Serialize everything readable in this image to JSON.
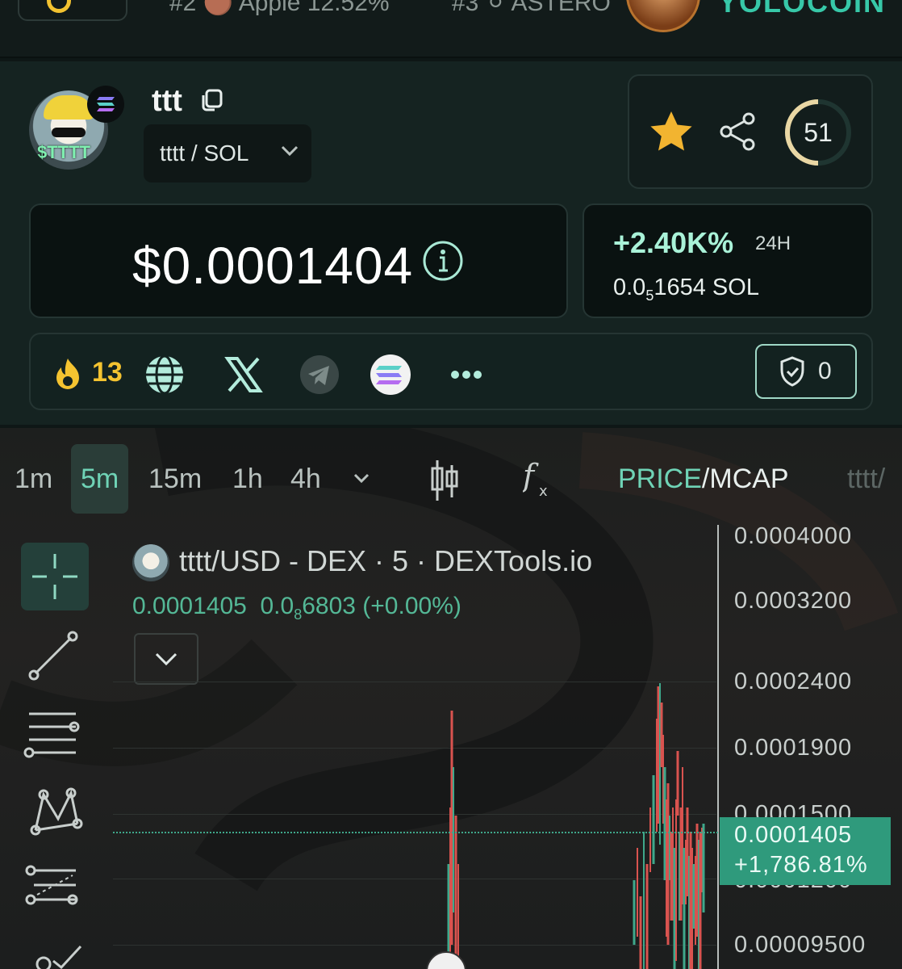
{
  "ticker": {
    "item2": "#2 🟤 Apple 12.52%",
    "item3": "#3 ⚪ ASTERO",
    "ad": "YOLOCOIN"
  },
  "token": {
    "name": "ttt",
    "pair": "tttt / SOL",
    "avatar_label": "$TTTT",
    "score": "51",
    "price": "$0.0001404",
    "change_pct": "+2.40K%",
    "change_period": "24H",
    "sol_price_prefix": "0.0",
    "sol_price_sub": "5",
    "sol_price_suffix": "1654 SOL",
    "hot_count": "13",
    "audit_count": "0"
  },
  "icons": [
    "solana-icon",
    "copy-icon",
    "chevron-down-icon",
    "star-icon",
    "share-icon",
    "info-icon",
    "fire-icon",
    "globe-icon",
    "x-icon",
    "telegram-icon",
    "solana-icon",
    "more-icon",
    "shield-icon"
  ],
  "chart": {
    "intervals": [
      "1m",
      "5m",
      "15m",
      "1h",
      "4h"
    ],
    "active_interval": "5m",
    "price_label": "PRICE",
    "mcap_label": "/MCAP",
    "symbol_tab": "tttt/",
    "legend_title": "tttt/USD - DEX · 5 · DEXTools.io",
    "legend_price": "0.0001405",
    "legend_change_prefix": "0.0",
    "legend_change_sub": "8",
    "legend_change_suffix": "6803 (+0.00%)",
    "y_ticks": [
      "0.0004000",
      "0.0003200",
      "0.0002400",
      "0.0001900",
      "0.0001500",
      "0.0001200",
      "0.00009500"
    ],
    "last_price": "0.0001405",
    "last_change": "+1,786.81%"
  },
  "colors": {
    "accent": "#6fd3b6",
    "up": "#3fa88b",
    "down": "#d9534f",
    "gold": "#f4c330"
  }
}
